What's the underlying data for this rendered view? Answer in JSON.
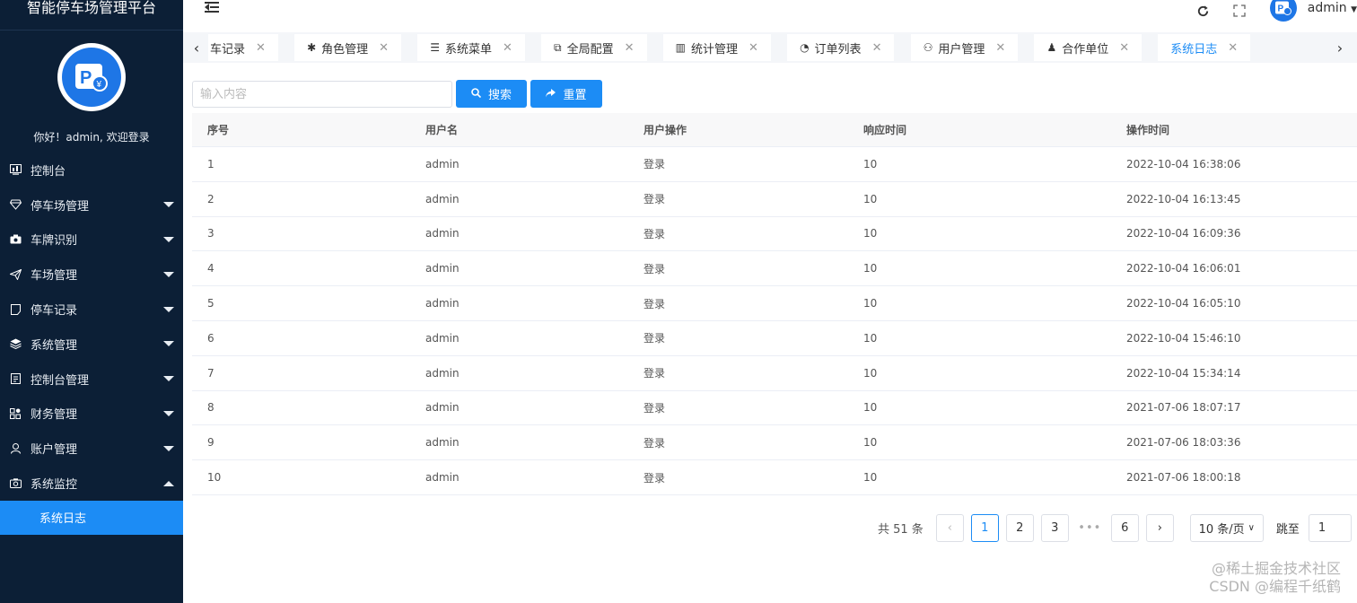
{
  "app": {
    "title": "智能停车场管理平台",
    "welcome": "你好！admin, 欢迎登录"
  },
  "sidebar": {
    "items": [
      {
        "label": "控制台",
        "icon": "dashboard-icon",
        "expandable": false
      },
      {
        "label": "停车场管理",
        "icon": "diamond-icon",
        "expandable": true
      },
      {
        "label": "车牌识别",
        "icon": "camera-icon",
        "expandable": true
      },
      {
        "label": "车场管理",
        "icon": "paper-plane-icon",
        "expandable": true
      },
      {
        "label": "停车记录",
        "icon": "document-icon",
        "expandable": true
      },
      {
        "label": "系统管理",
        "icon": "layers-icon",
        "expandable": true
      },
      {
        "label": "控制台管理",
        "icon": "clipboard-icon",
        "expandable": true
      },
      {
        "label": "财务管理",
        "icon": "apps-icon",
        "expandable": true
      },
      {
        "label": "账户管理",
        "icon": "user-icon",
        "expandable": true
      },
      {
        "label": "系统监控",
        "icon": "monitor-icon",
        "expandable": true,
        "expanded": true
      }
    ],
    "subitem": "系统日志"
  },
  "header": {
    "user": "admin"
  },
  "tabs": [
    {
      "label": "车记录",
      "icon": ""
    },
    {
      "label": "角色管理",
      "icon": "✱"
    },
    {
      "label": "系统菜单",
      "icon": "☰"
    },
    {
      "label": "全局配置",
      "icon": "⧉"
    },
    {
      "label": "统计管理",
      "icon": "▥"
    },
    {
      "label": "订单列表",
      "icon": "◔"
    },
    {
      "label": "用户管理",
      "icon": "⚇"
    },
    {
      "label": "合作单位",
      "icon": "♟"
    },
    {
      "label": "系统日志",
      "icon": "",
      "active": true
    }
  ],
  "search": {
    "placeholder": "输入内容",
    "search_label": "搜索",
    "reset_label": "重置"
  },
  "table": {
    "headers": [
      "序号",
      "用户名",
      "用户操作",
      "响应时间",
      "操作时间"
    ],
    "rows": [
      [
        "1",
        "admin",
        "登录",
        "10",
        "2022-10-04 16:38:06"
      ],
      [
        "2",
        "admin",
        "登录",
        "10",
        "2022-10-04 16:13:45"
      ],
      [
        "3",
        "admin",
        "登录",
        "10",
        "2022-10-04 16:09:36"
      ],
      [
        "4",
        "admin",
        "登录",
        "10",
        "2022-10-04 16:06:01"
      ],
      [
        "5",
        "admin",
        "登录",
        "10",
        "2022-10-04 16:05:10"
      ],
      [
        "6",
        "admin",
        "登录",
        "10",
        "2022-10-04 15:46:10"
      ],
      [
        "7",
        "admin",
        "登录",
        "10",
        "2022-10-04 15:34:14"
      ],
      [
        "8",
        "admin",
        "登录",
        "10",
        "2021-07-06 18:07:17"
      ],
      [
        "9",
        "admin",
        "登录",
        "10",
        "2021-07-06 18:03:36"
      ],
      [
        "10",
        "admin",
        "登录",
        "10",
        "2021-07-06 18:00:18"
      ]
    ]
  },
  "pagination": {
    "total": "共 51 条",
    "pages": [
      "1",
      "2",
      "3"
    ],
    "last_page": "6",
    "current": "1",
    "page_size": "10 条/页",
    "jump_label": "跳至",
    "jump_value": "1"
  },
  "watermark": {
    "line1": "@稀土掘金技术社区",
    "line2": "CSDN @编程千纸鹤"
  },
  "colors": {
    "sidebar_bg": "#0c1f36",
    "accent": "#1c8cf5"
  }
}
